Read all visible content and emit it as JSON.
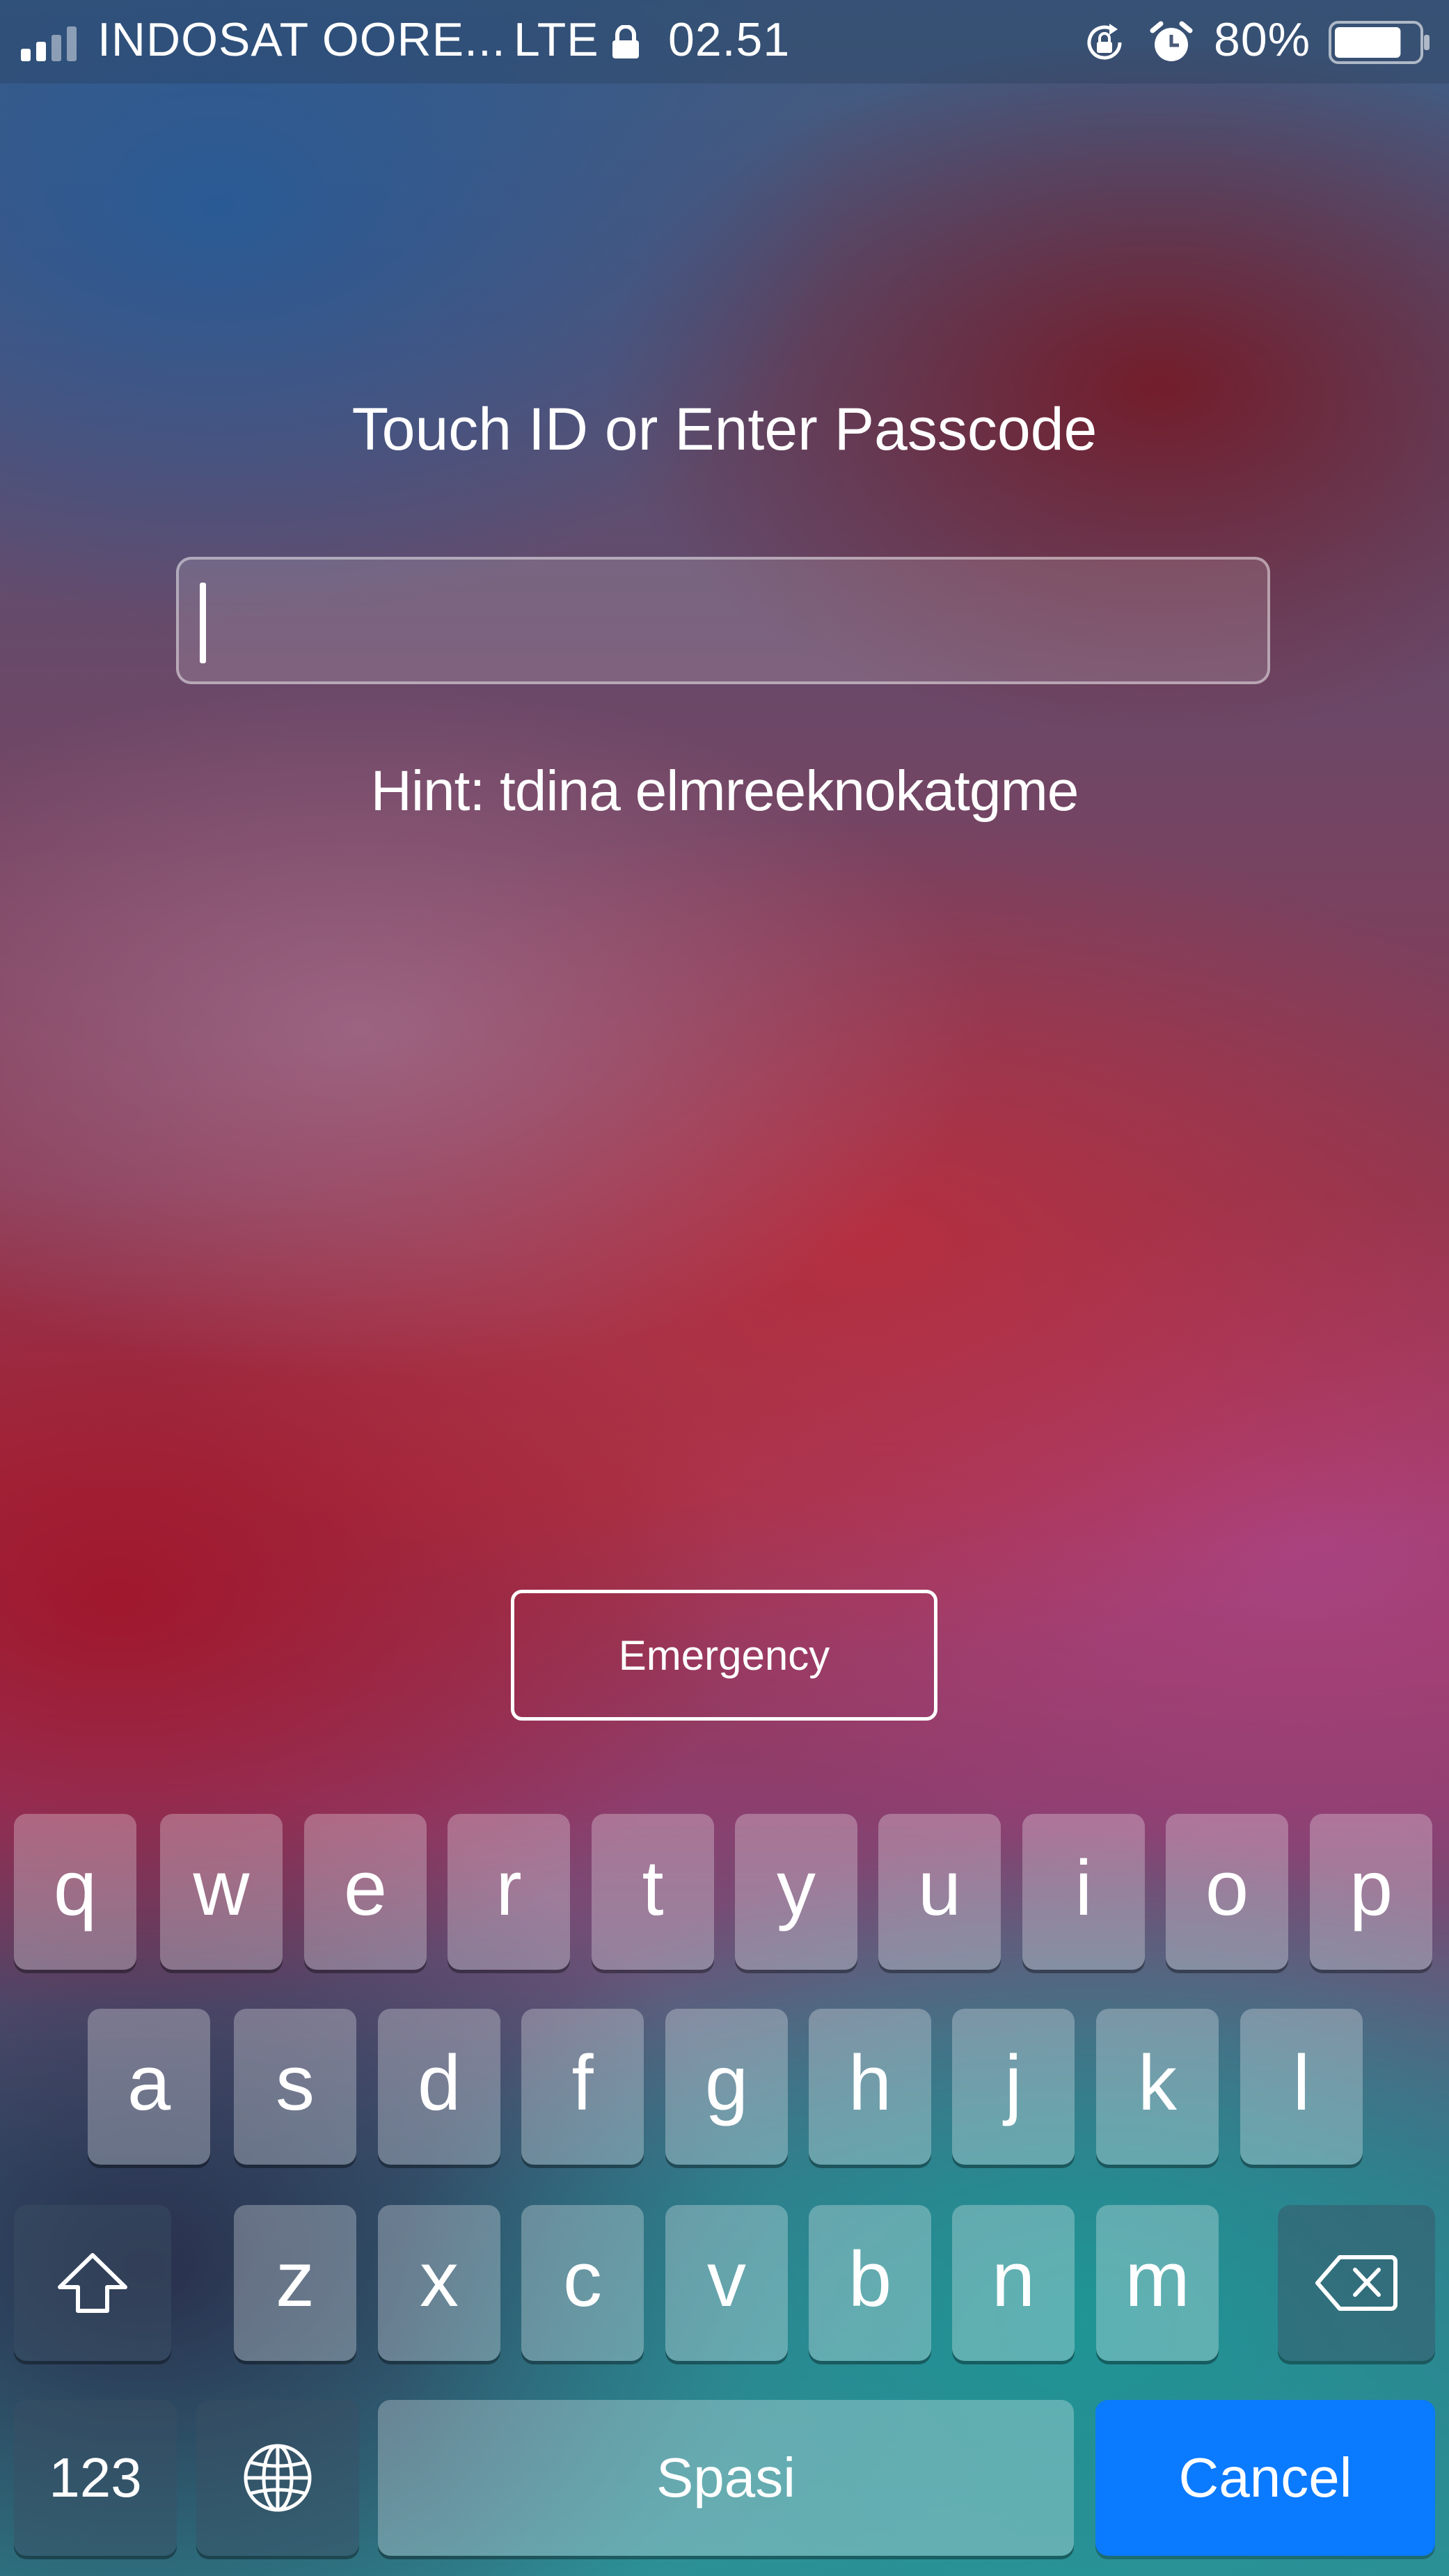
{
  "status_bar": {
    "carrier": "INDOSAT OORE...",
    "network": "LTE",
    "time": "02.51",
    "battery_percent": "80%",
    "battery_level": 0.8,
    "icons": [
      "signal-icon",
      "lock-icon",
      "rotation-lock-icon",
      "alarm-icon",
      "battery-icon"
    ]
  },
  "lock_screen": {
    "prompt": "Touch ID or Enter Passcode",
    "passcode_value": "",
    "hint": "Hint: tdina elmreeknokatgme",
    "emergency_label": "Emergency"
  },
  "keyboard": {
    "row1": [
      "q",
      "w",
      "e",
      "r",
      "t",
      "y",
      "u",
      "i",
      "o",
      "p"
    ],
    "row2": [
      "a",
      "s",
      "d",
      "f",
      "g",
      "h",
      "j",
      "k",
      "l"
    ],
    "row3": [
      "z",
      "x",
      "c",
      "v",
      "b",
      "n",
      "m"
    ],
    "numbers_label": "123",
    "space_label": "Spasi",
    "cancel_label": "Cancel",
    "shift_icon": "shift-icon",
    "delete_icon": "delete-icon",
    "globe_icon": "globe-icon"
  },
  "colors": {
    "cancel_button": "#0a7aff"
  }
}
